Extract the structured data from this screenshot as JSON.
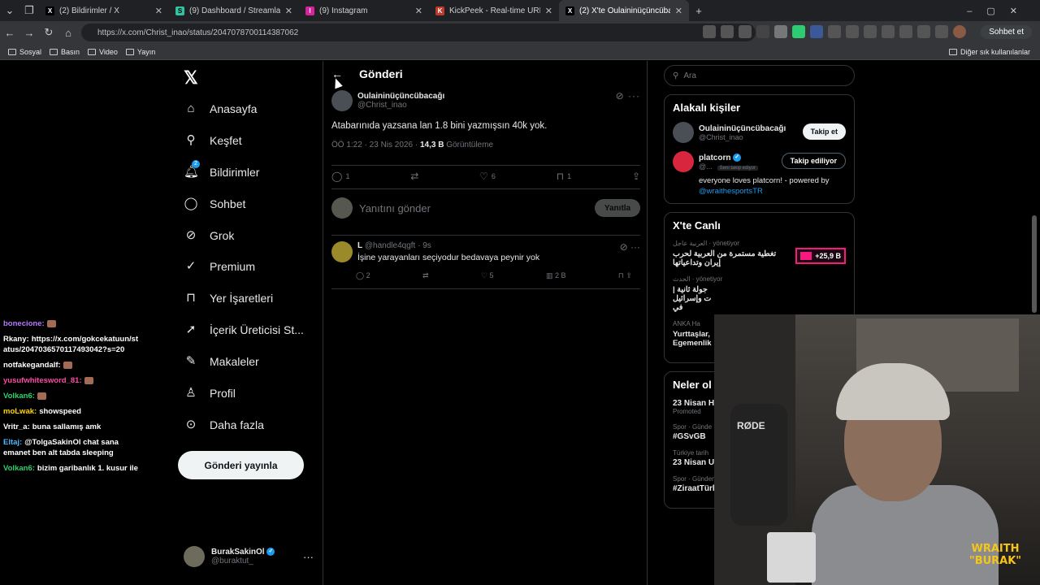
{
  "browser": {
    "tabs": [
      {
        "label": "(2) Bildirimler / X",
        "favicon": "X"
      },
      {
        "label": "(9) Dashboard / Streamlabs",
        "favicon": "S"
      },
      {
        "label": "(9) Instagram",
        "favicon": "I"
      },
      {
        "label": "KickPeek - Real-time URL Crawler",
        "favicon": "K"
      },
      {
        "label": "(2) X'te Oulaininüçüncübacağı: \"@",
        "favicon": "X"
      }
    ],
    "new_tab_icon": "+",
    "url": "https://x.com/Christ_inao/status/2047078700114387062",
    "chat_button": "Sohbet et",
    "bookmarks": [
      "Sosyal",
      "Basın",
      "Video",
      "Yayın"
    ],
    "other_bookmarks": "Diğer sık kullanılanlar"
  },
  "nav": {
    "items": [
      {
        "label": "Anasayfa",
        "icon": "home-icon"
      },
      {
        "label": "Keşfet",
        "icon": "search-icon"
      },
      {
        "label": "Bildirimler",
        "icon": "bell-icon",
        "badge": "2"
      },
      {
        "label": "Sohbet",
        "icon": "chat-icon"
      },
      {
        "label": "Grok",
        "icon": "grok-icon"
      },
      {
        "label": "Premium",
        "icon": "premium-icon"
      },
      {
        "label": "Yer İşaretleri",
        "icon": "bookmark-icon"
      },
      {
        "label": "İçerik Üreticisi St...",
        "icon": "rocket-icon"
      },
      {
        "label": "Makaleler",
        "icon": "article-icon"
      },
      {
        "label": "Profil",
        "icon": "person-icon"
      },
      {
        "label": "Daha fazla",
        "icon": "more-icon"
      }
    ],
    "post_button": "Gönderi yayınla",
    "account": {
      "name": "BurakSakinOl",
      "handle": "@buraktut_"
    }
  },
  "main": {
    "header_title": "Gönderi",
    "tweet": {
      "author_name": "Oulaininüçüncübacağı",
      "author_handle": "@Christ_inao",
      "text": "Atabarınıda yazsana lan 1.8 bini yazmışsın 40k  yok.",
      "time": "ÖÖ 1:22 · 23 Nis 2026 ·",
      "views": "14,3 B",
      "views_label": "Görüntüleme",
      "replies": "1",
      "likes": "6",
      "bookmarks": "1"
    },
    "reply_placeholder": "Yanıtını gönder",
    "reply_button": "Yanıtla",
    "reply": {
      "author_name": "L",
      "author_handle": "@handle4qgft",
      "time": "· 9s",
      "text": "İşine yarayanları seçiyodur bedavaya peynir yok",
      "replies": "2",
      "likes": "5",
      "views": "2 B"
    }
  },
  "right": {
    "search_placeholder": "Ara",
    "relevant_title": "Alakalı kişiler",
    "people": [
      {
        "name": "Oulaininüçüncübacağı",
        "handle": "@Christ_inao",
        "button": "Takip et"
      },
      {
        "name": "platcorn",
        "handle": "@...",
        "follows_you": "Seni takip ediyor",
        "button": "Takip ediliyor",
        "bio": "everyone loves platcorn! - powered by",
        "bio_link": "@wraithesportsTR"
      }
    ],
    "live_title": "X'te Canlı",
    "live": [
      {
        "source": "العربية عاجل · yönetiyor",
        "text": "تغطية مستمرة من العربية لحرب إيران وتداعياتها",
        "badge": "+25,9 B"
      },
      {
        "source": "الحدث · yönetiyor",
        "text": "جولة ثانية | ت وإسرائيل في"
      },
      {
        "source": "ANKA Ha",
        "text": "Yurttaşlar, Egemenlik"
      }
    ],
    "trends_title": "Neler ol",
    "trends": [
      {
        "category": "",
        "name": "23 Nisan H",
        "sub": "Promoted"
      },
      {
        "category": "Spor · Günde",
        "name": "#GSvGB"
      },
      {
        "category": "Türkiye tarih",
        "name": "23 Nisan U"
      },
      {
        "category": "Spor · Gündemdekiler",
        "name": "#ZiraatTürkiyeKupası"
      }
    ]
  },
  "chat": [
    {
      "user": "bonecione:",
      "text": "",
      "user_color": "#b479ff"
    },
    {
      "user": "Rkany:",
      "text": "https://x.com/gokcekatuun/status/2047036570117493042?s=20",
      "user_color": "#ffffff"
    },
    {
      "user": "notfakegandalf:",
      "text": "",
      "user_color": "#ffffff"
    },
    {
      "user": "yusufwhitesword_81:",
      "text": "",
      "user_color": "#ff4aa5"
    },
    {
      "user": "Volkan6:",
      "text": "",
      "user_color": "#2dd36f"
    },
    {
      "user": "moLwak:",
      "text": "showspeed",
      "user_color": "#ffd700"
    },
    {
      "user": "Vritr_a:",
      "text": "buna sallamış amk",
      "user_color": "#ffffff"
    },
    {
      "user": "Eltaj:",
      "text": "@TolgaSakinOl chat sana emanet ben alt tabda sleeping",
      "user_color": "#4ab8ff"
    },
    {
      "user": "Volkan6:",
      "text": "bizim garibanlık 1. kusur ile",
      "user_color": "#2dd36f"
    }
  ],
  "webcam": {
    "mic_brand": "RØDE",
    "logo_line1": "WRAITH",
    "logo_line2": "\"BURAK\""
  }
}
